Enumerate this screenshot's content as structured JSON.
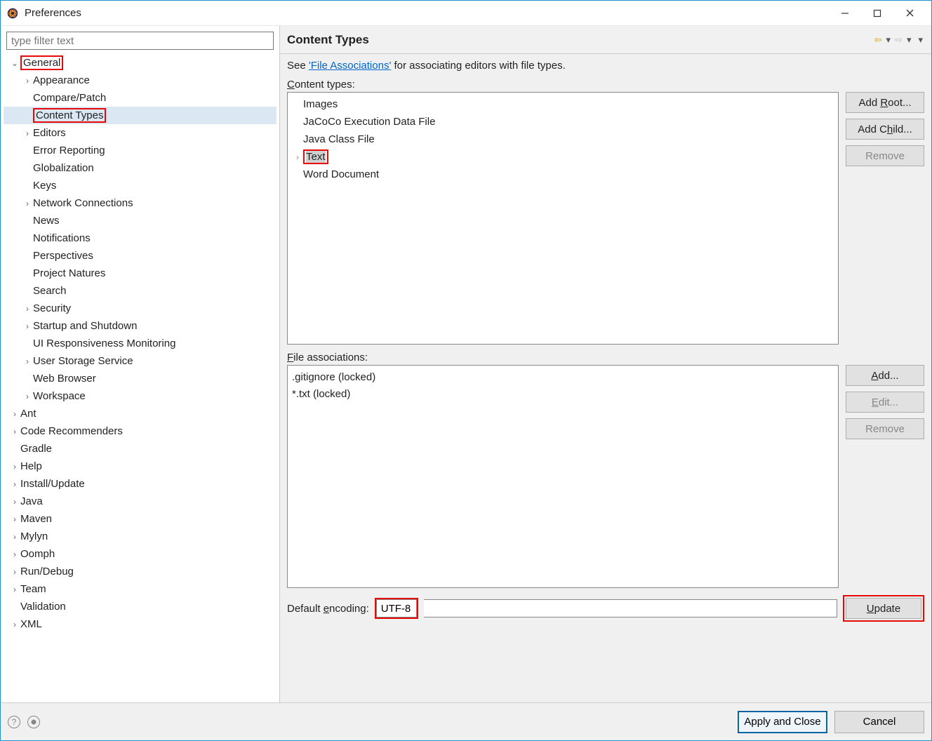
{
  "window": {
    "title": "Preferences"
  },
  "filter": {
    "placeholder": "type filter text"
  },
  "tree": [
    {
      "label": "General",
      "indent": 0,
      "expand": "down",
      "highlight": true,
      "children": [
        {
          "label": "Appearance",
          "indent": 1,
          "expand": "right"
        },
        {
          "label": "Compare/Patch",
          "indent": 1,
          "expand": ""
        },
        {
          "label": "Content Types",
          "indent": 1,
          "expand": "",
          "highlight": true,
          "selected": true
        },
        {
          "label": "Editors",
          "indent": 1,
          "expand": "right"
        },
        {
          "label": "Error Reporting",
          "indent": 1,
          "expand": ""
        },
        {
          "label": "Globalization",
          "indent": 1,
          "expand": ""
        },
        {
          "label": "Keys",
          "indent": 1,
          "expand": ""
        },
        {
          "label": "Network Connections",
          "indent": 1,
          "expand": "right"
        },
        {
          "label": "News",
          "indent": 1,
          "expand": ""
        },
        {
          "label": "Notifications",
          "indent": 1,
          "expand": ""
        },
        {
          "label": "Perspectives",
          "indent": 1,
          "expand": ""
        },
        {
          "label": "Project Natures",
          "indent": 1,
          "expand": ""
        },
        {
          "label": "Search",
          "indent": 1,
          "expand": ""
        },
        {
          "label": "Security",
          "indent": 1,
          "expand": "right"
        },
        {
          "label": "Startup and Shutdown",
          "indent": 1,
          "expand": "right"
        },
        {
          "label": "UI Responsiveness Monitoring",
          "indent": 1,
          "expand": ""
        },
        {
          "label": "User Storage Service",
          "indent": 1,
          "expand": "right"
        },
        {
          "label": "Web Browser",
          "indent": 1,
          "expand": ""
        },
        {
          "label": "Workspace",
          "indent": 1,
          "expand": "right"
        }
      ]
    },
    {
      "label": "Ant",
      "indent": 0,
      "expand": "right"
    },
    {
      "label": "Code Recommenders",
      "indent": 0,
      "expand": "right"
    },
    {
      "label": "Gradle",
      "indent": 0,
      "expand": ""
    },
    {
      "label": "Help",
      "indent": 0,
      "expand": "right"
    },
    {
      "label": "Install/Update",
      "indent": 0,
      "expand": "right"
    },
    {
      "label": "Java",
      "indent": 0,
      "expand": "right"
    },
    {
      "label": "Maven",
      "indent": 0,
      "expand": "right"
    },
    {
      "label": "Mylyn",
      "indent": 0,
      "expand": "right"
    },
    {
      "label": "Oomph",
      "indent": 0,
      "expand": "right"
    },
    {
      "label": "Run/Debug",
      "indent": 0,
      "expand": "right"
    },
    {
      "label": "Team",
      "indent": 0,
      "expand": "right"
    },
    {
      "label": "Validation",
      "indent": 0,
      "expand": ""
    },
    {
      "label": "XML",
      "indent": 0,
      "expand": "right"
    }
  ],
  "page": {
    "title": "Content Types",
    "desc_prefix": "See ",
    "desc_link": "'File Associations'",
    "desc_suffix": " for associating editors with file types.",
    "content_types_label": "Content types:",
    "content_types": [
      {
        "label": "Images",
        "expand": ""
      },
      {
        "label": "JaCoCo Execution Data File",
        "expand": ""
      },
      {
        "label": "Java Class File",
        "expand": ""
      },
      {
        "label": "Text",
        "expand": "right",
        "highlight": true,
        "selected": true
      },
      {
        "label": "Word Document",
        "expand": ""
      }
    ],
    "ct_buttons": {
      "add_root": "Add Root...",
      "add_child": "Add Child...",
      "remove": "Remove"
    },
    "file_assoc_label": "File associations:",
    "file_assoc": [
      ".gitignore (locked)",
      "*.txt (locked)"
    ],
    "fa_buttons": {
      "add": "Add...",
      "edit": "Edit...",
      "remove": "Remove"
    },
    "encoding_label": "Default encoding:",
    "encoding_value": "UTF-8",
    "update_btn": "Update"
  },
  "footer": {
    "apply": "Apply and Close",
    "cancel": "Cancel"
  }
}
